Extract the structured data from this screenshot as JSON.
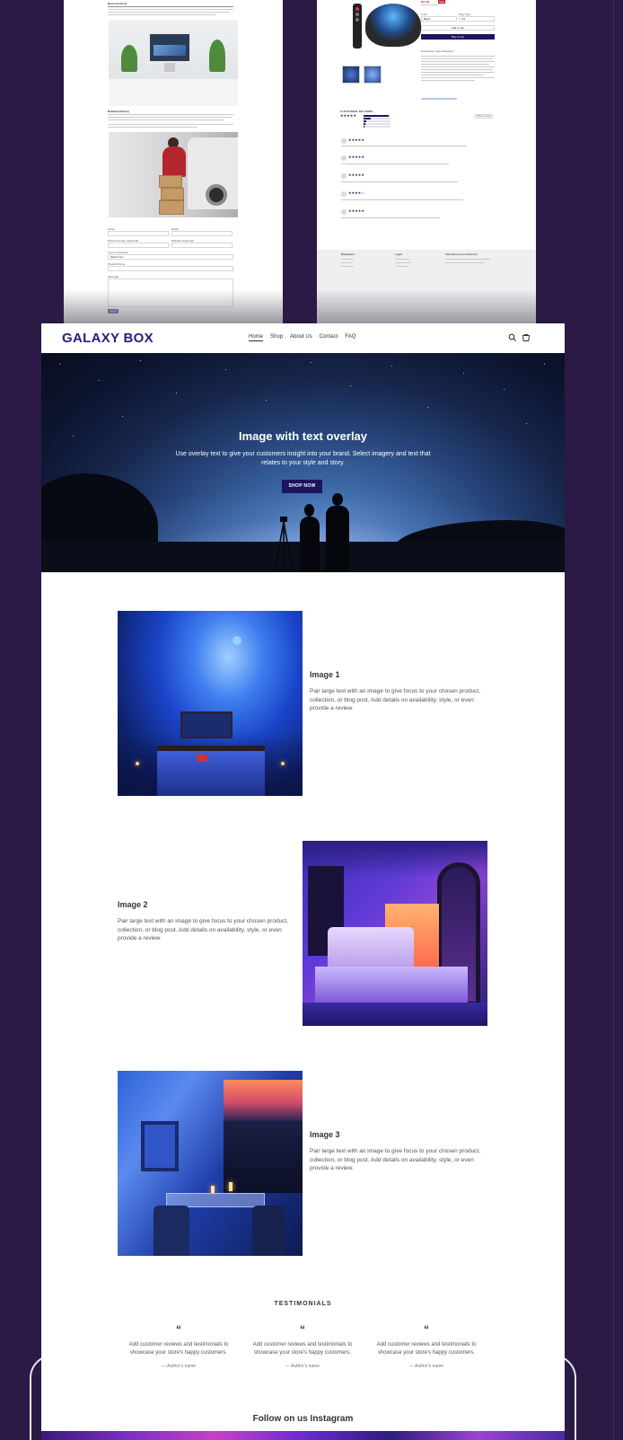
{
  "top_left_preview": {
    "section_heading": "Rich text block",
    "section2_heading": "Reliable Delivery",
    "form_labels": [
      "Name",
      "Email",
      "Phone Number (Optional)",
      "Website (Optional)",
      "Type of Question",
      "Product Name",
      "Message"
    ],
    "select_value": "Select One",
    "send_button": "Send"
  },
  "top_right_preview": {
    "price_sale": "$44.99",
    "badge": "Sale",
    "option_label_1": "Color",
    "option_label_2": "Plug Type",
    "option_value_1": "Black",
    "option_value_2": "US",
    "add_to_cart": "Add to cart",
    "buy_now": "Buy it now",
    "tabs": [
      "Description",
      "Specs",
      "Reviews"
    ],
    "reviews_heading": "CUSTOMER REVIEWS",
    "write_review": "Write a review",
    "footer_cols": [
      "Navigation",
      "Legal",
      "Talk about your business"
    ]
  },
  "header": {
    "logo_text": "GALAXY BOX",
    "nav": [
      "Home",
      "Shop",
      "About Us",
      "Contact",
      "FAQ"
    ]
  },
  "hero": {
    "title": "Image with text overlay",
    "text": "Use overlay text to give your customers insight into your brand. Select imagery and text that relates to your style and story.",
    "button": "SHOP NOW"
  },
  "features": [
    {
      "title": "Image 1",
      "text": "Pair large text with an image to give focus to your chosen product, collection, or blog post. Add details on availability, style, or even provide a review."
    },
    {
      "title": "Image 2",
      "text": "Pair large text with an image to give focus to your chosen product, collection, or blog post. Add details on availability, style, or even provide a review."
    },
    {
      "title": "Image 3",
      "text": "Pair large text with an image to give focus to your chosen product, collection, or blog post. Add details on availability, style, or even provide a review."
    }
  ],
  "testimonials": {
    "title": "TESTIMONIALS",
    "items": [
      {
        "quote_mark": "“",
        "text": "Add customer reviews and testimonials to showcase your store's happy customers.",
        "author": "— Author's name"
      },
      {
        "quote_mark": "“",
        "text": "Add customer reviews and testimonials to showcase your store's happy customers.",
        "author": "— Author's name"
      },
      {
        "quote_mark": "“",
        "text": "Add customer reviews and testimonials to showcase your store's happy customers.",
        "author": "— Author's name"
      }
    ]
  },
  "instagram": {
    "title": "Follow on us Instagram"
  },
  "colors": {
    "background": "#2a1a45",
    "brand": "#28217a",
    "button": "#1d1460"
  }
}
